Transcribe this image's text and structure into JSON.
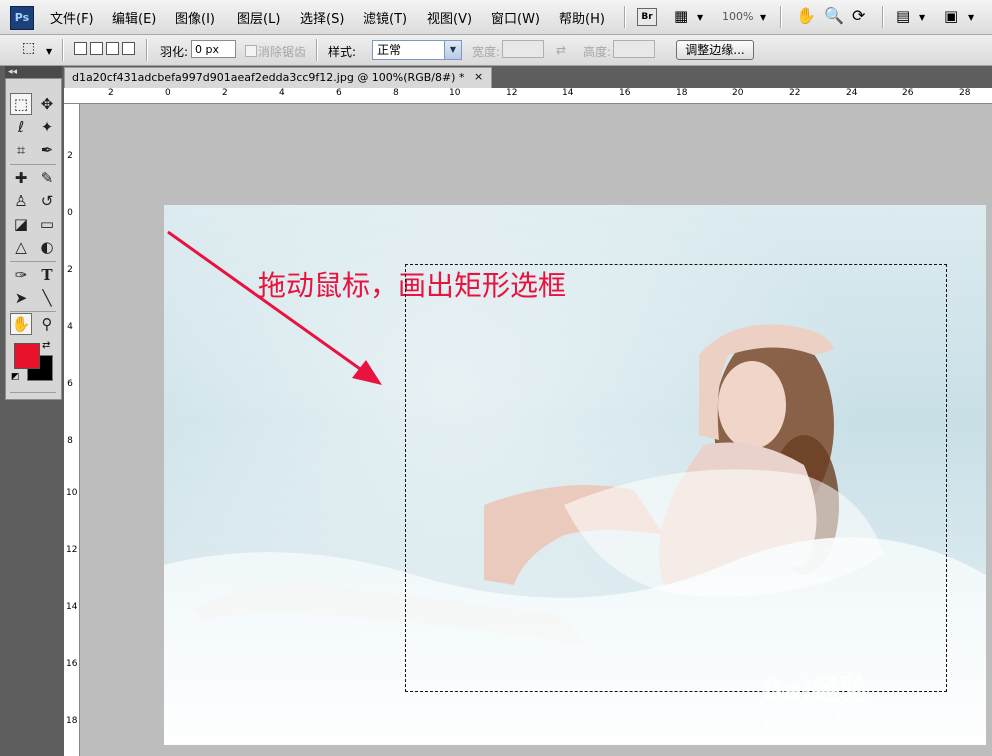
{
  "app": {
    "logo": "Ps",
    "bridge_badge": "Br",
    "zoom_level": "100%"
  },
  "menu": [
    {
      "label": "文件(F)"
    },
    {
      "label": "编辑(E)"
    },
    {
      "label": "图像(I)"
    },
    {
      "label": "图层(L)"
    },
    {
      "label": "选择(S)"
    },
    {
      "label": "滤镜(T)"
    },
    {
      "label": "视图(V)"
    },
    {
      "label": "窗口(W)"
    },
    {
      "label": "帮助(H)"
    }
  ],
  "options": {
    "feather_label": "羽化:",
    "feather_value": "0 px",
    "antialias_label": "消除锯齿",
    "style_label": "样式:",
    "style_value": "正常",
    "width_label": "宽度:",
    "height_label": "高度:",
    "refine_edge_button": "调整边缘..."
  },
  "tools": {
    "panel_collapse": "◂◂",
    "icons": [
      "rect-marquee-icon",
      "move-icon",
      "lasso-icon",
      "magic-wand-icon",
      "crop-icon",
      "eyedropper-icon",
      "healing-brush-icon",
      "brush-icon",
      "clone-stamp-icon",
      "history-brush-icon",
      "eraser-icon",
      "gradient-icon",
      "blur-icon",
      "dodge-icon",
      "pen-icon",
      "type-icon",
      "path-select-icon",
      "line-icon",
      "hand-icon",
      "zoom-icon"
    ],
    "foreground_color": "#e8132a",
    "background_color": "#000000"
  },
  "document": {
    "tab_title": "d1a20cf431adcbefa997d901aeaf2edda3cc9f12.jpg @ 100%(RGB/8#) *",
    "close_glyph": "×"
  },
  "ruler": {
    "top_ticks": [
      "2",
      "0",
      "2",
      "4",
      "6",
      "8",
      "10",
      "12",
      "14",
      "16",
      "18",
      "20",
      "22",
      "24",
      "26",
      "28"
    ],
    "left_ticks": [
      "2",
      "0",
      "2",
      "4",
      "6",
      "8",
      "10",
      "12",
      "14",
      "16",
      "18"
    ]
  },
  "canvas": {
    "annotation_text": "拖动鼠标，画出矩形选框",
    "watermark_text": "Bai经验",
    "watermark_url": "jingyan.baidu.com",
    "annotation_color": "#e8133e"
  }
}
